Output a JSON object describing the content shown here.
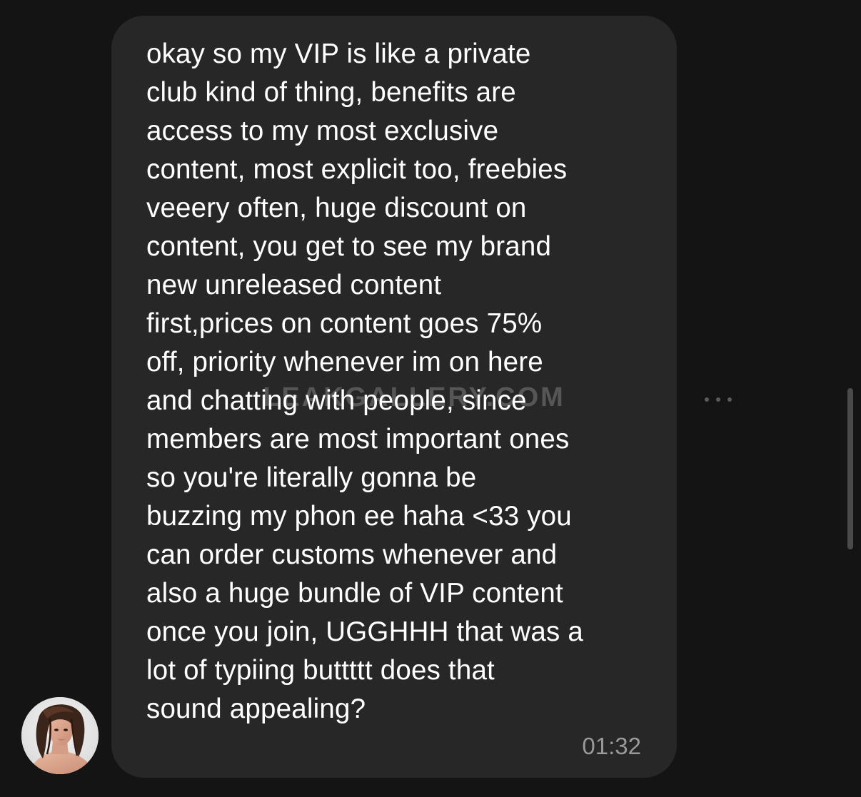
{
  "chat": {
    "message": {
      "lines": [
        "okay so my VIP is like a private",
        "club kind of thing, benefits are",
        "access to my most exclusive",
        "content, most explicit too, freebies",
        "veeery often, huge discount on",
        "content, you get to see my brand",
        "new unreleased content",
        "first,prices on content goes 75%",
        "off, priority whenever im on here",
        "and chatting with people, since",
        "members are most important ones",
        "so you're literally gonna be",
        "buzzing my phon ee haha <33 you",
        "can order customs whenever and",
        "also a huge bundle of VIP content",
        "once you join, UGGHHH that was a",
        "lot of typiing buttttt does that",
        "sound appealing?"
      ],
      "timestamp": "01:32"
    },
    "watermark": "LEAKGALLERY.COM",
    "colors": {
      "background": "#141414",
      "bubble": "#272727",
      "text": "#ffffff",
      "timestamp": "#9a9a9a"
    },
    "icons": {
      "more": "more-horizontal-icon",
      "avatar": "user-avatar"
    }
  }
}
